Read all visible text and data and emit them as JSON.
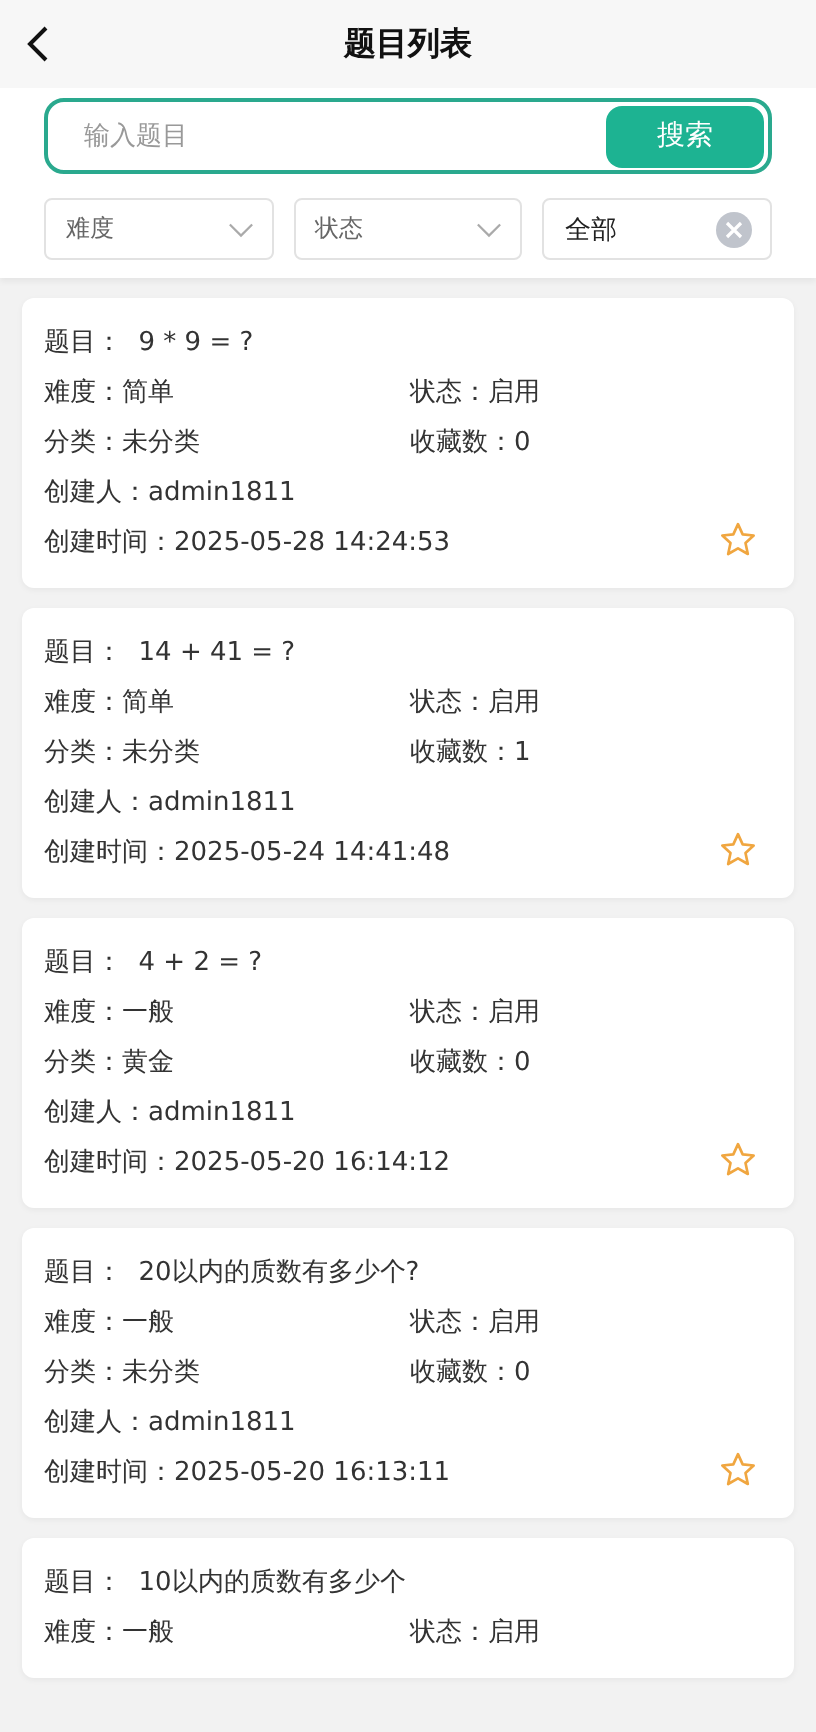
{
  "header": {
    "title": "题目列表"
  },
  "search": {
    "placeholder": "输入题目",
    "button": "搜索"
  },
  "filters": [
    {
      "kind": "select",
      "placeholder": "难度"
    },
    {
      "kind": "select",
      "placeholder": "状态"
    },
    {
      "kind": "clearable",
      "value": "全部"
    }
  ],
  "cards": [
    {
      "question": {
        "label": "题目：",
        "value": "9 * 9 = ?"
      },
      "favorited": false,
      "fields": [
        {
          "kind": "half",
          "label": "难度：",
          "value": "简单"
        },
        {
          "kind": "half",
          "label": "状态：",
          "value": "启用"
        },
        {
          "kind": "half",
          "label": "分类：",
          "value": "未分类"
        },
        {
          "kind": "half",
          "label": "收藏数：",
          "value": "0"
        },
        {
          "kind": "full",
          "label": "创建人：",
          "value": "admin1811"
        },
        {
          "kind": "full",
          "label": "创建时间：",
          "value": "2025-05-28 14:24:53"
        }
      ]
    },
    {
      "question": {
        "label": "题目：",
        "value": "14 + 41 = ?"
      },
      "favorited": false,
      "fields": [
        {
          "kind": "half",
          "label": "难度：",
          "value": "简单"
        },
        {
          "kind": "half",
          "label": "状态：",
          "value": "启用"
        },
        {
          "kind": "half",
          "label": "分类：",
          "value": "未分类"
        },
        {
          "kind": "half",
          "label": "收藏数：",
          "value": "1"
        },
        {
          "kind": "full",
          "label": "创建人：",
          "value": "admin1811"
        },
        {
          "kind": "full",
          "label": "创建时间：",
          "value": "2025-05-24 14:41:48"
        }
      ]
    },
    {
      "question": {
        "label": "题目：",
        "value": "4 + 2 = ?"
      },
      "favorited": false,
      "fields": [
        {
          "kind": "half",
          "label": "难度：",
          "value": "一般"
        },
        {
          "kind": "half",
          "label": "状态：",
          "value": "启用"
        },
        {
          "kind": "half",
          "label": "分类：",
          "value": "黄金"
        },
        {
          "kind": "half",
          "label": "收藏数：",
          "value": "0"
        },
        {
          "kind": "full",
          "label": "创建人：",
          "value": "admin1811"
        },
        {
          "kind": "full",
          "label": "创建时间：",
          "value": "2025-05-20 16:14:12"
        }
      ]
    },
    {
      "question": {
        "label": "题目：",
        "value": "20以内的质数有多少个?"
      },
      "favorited": false,
      "fields": [
        {
          "kind": "half",
          "label": "难度：",
          "value": "一般"
        },
        {
          "kind": "half",
          "label": "状态：",
          "value": "启用"
        },
        {
          "kind": "half",
          "label": "分类：",
          "value": "未分类"
        },
        {
          "kind": "half",
          "label": "收藏数：",
          "value": "0"
        },
        {
          "kind": "full",
          "label": "创建人：",
          "value": "admin1811"
        },
        {
          "kind": "full",
          "label": "创建时间：",
          "value": "2025-05-20 16:13:11"
        }
      ]
    },
    {
      "question": {
        "label": "题目：",
        "value": "10以内的质数有多少个"
      },
      "fields": [
        {
          "kind": "half",
          "label": "难度：",
          "value": "一般"
        },
        {
          "kind": "half",
          "label": "状态：",
          "value": "启用"
        }
      ]
    }
  ]
}
